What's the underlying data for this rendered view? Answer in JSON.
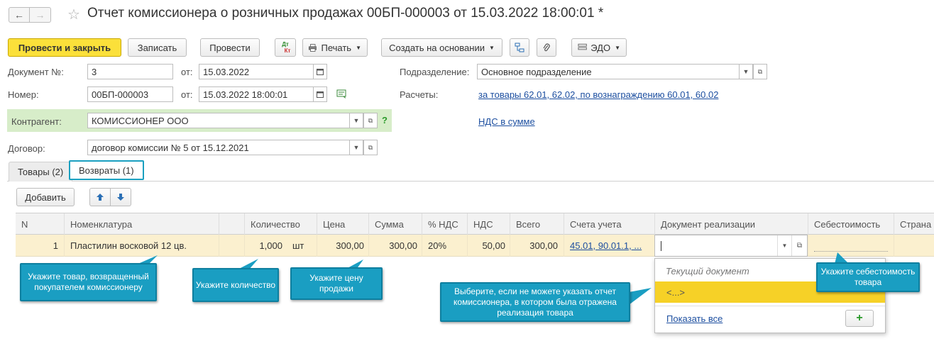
{
  "title": "Отчет комиссионера о розничных продажах 00БП-000003 от 15.03.2022 18:00:01 *",
  "nav": {
    "back": "←",
    "forward": "→",
    "star": "☆"
  },
  "toolbar": {
    "post_close": "Провести и закрыть",
    "save": "Записать",
    "post": "Провести",
    "dtkt_top": "Дт",
    "dtkt_bottom": "Кт",
    "print": "Печать",
    "create_basis": "Создать на основании",
    "edo": "ЭДО"
  },
  "form": {
    "doc_no_label": "Документ №:",
    "doc_no_value": "3",
    "from_label": "от:",
    "doc_date": "15.03.2022",
    "number_label": "Номер:",
    "number_value": "00БП-000003",
    "number_date": "15.03.2022 18:00:01",
    "division_label": "Подразделение:",
    "division_value": "Основное подразделение",
    "settlements_label": "Расчеты:",
    "settlements_link": "за товары 62.01, 62.02, по вознаграждению 60.01, 60.02",
    "counterparty_label": "Контрагент:",
    "counterparty_value": "КОМИССИОНЕР ООО",
    "help": "?",
    "vat_link": "НДС в сумме",
    "contract_label": "Договор:",
    "contract_value": "договор комиссии № 5 от 15.12.2021"
  },
  "tabs": [
    {
      "label": "Товары (2)"
    },
    {
      "label": "Возвраты (1)"
    }
  ],
  "table_toolbar": {
    "add": "Добавить"
  },
  "table": {
    "columns": [
      "N",
      "Номенклатура",
      "Количество",
      "Цена",
      "Сумма",
      "% НДС",
      "НДС",
      "Всего",
      "Счета учета",
      "Документ реализации",
      "Себестоимость",
      "Страна"
    ],
    "row": {
      "n": "1",
      "item": "Пластилин восковой 12 цв.",
      "qty": "1,000",
      "unit": "шт",
      "price": "300,00",
      "sum": "300,00",
      "vat_rate": "20%",
      "vat": "50,00",
      "total": "300,00",
      "accounts": "45.01, 90.01.1, ..."
    }
  },
  "popup": {
    "current_doc": "Текущий документ",
    "empty_option": "<...>",
    "show_all": "Показать все",
    "add": "+"
  },
  "callouts": {
    "item": "Укажите товар, возвращенный покупателем комиссионеру",
    "qty": "Укажите количество",
    "price": "Укажите цену продажи",
    "doc": "Выберите, если не можете указать отчет комиссионера, в котором была отражена реализация товара",
    "cost": "Укажите себестоимость товара"
  }
}
